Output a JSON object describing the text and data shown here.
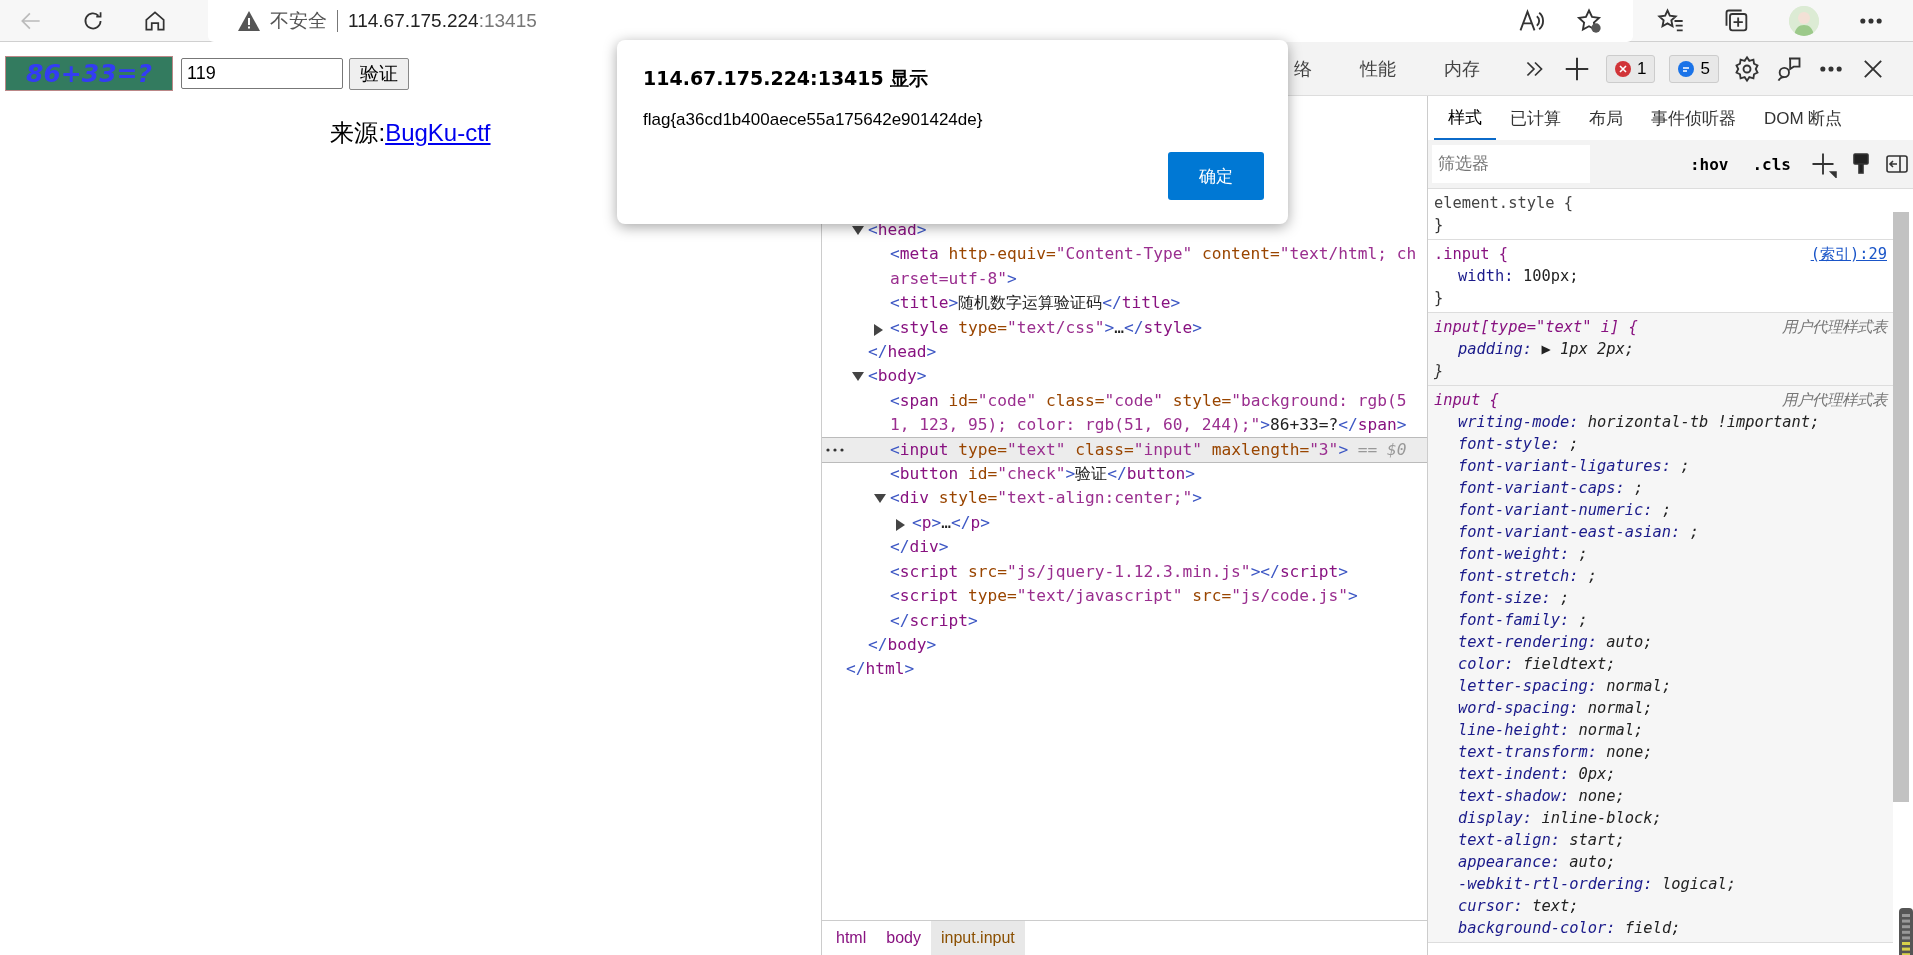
{
  "browser": {
    "address": {
      "security": "不安全",
      "host": "114.67.175.224",
      "port": ":13415"
    }
  },
  "page": {
    "captcha": "86+33=?",
    "answer_value": "119",
    "verify_button": "验证",
    "source_label": "来源:",
    "source_link": "BugKu-ctf"
  },
  "dialog": {
    "title": "114.67.175.224:13415 显示",
    "message": "flag{a36cd1b400aece55a175642e901424de}",
    "ok_button": "确定"
  },
  "devtools": {
    "tabs": [
      {
        "label": "络",
        "selected": false
      },
      {
        "label": "性能",
        "selected": false
      },
      {
        "label": "内存",
        "selected": false
      }
    ],
    "error_count": "1",
    "message_count": "5",
    "dom_tree": {
      "children": [
        {
          "selected": false,
          "expanded": true,
          "open": [
            {
              "kind": "punct",
              "t": "<"
            },
            {
              "kind": "tag",
              "t": "head"
            },
            {
              "kind": "punct",
              "t": ">"
            }
          ],
          "children": [
            {
              "selected": false,
              "open": [
                {
                  "kind": "punct",
                  "t": "<"
                },
                {
                  "kind": "tag",
                  "t": "meta"
                },
                {
                  "kind": "attr",
                  "t": " http-equiv="
                },
                {
                  "kind": "value",
                  "t": "\"Content-Type\""
                },
                {
                  "kind": "attr",
                  "t": " content="
                },
                {
                  "kind": "value",
                  "t": "\"text/html; charset=utf-8\""
                },
                {
                  "kind": "punct",
                  "t": ">"
                }
              ]
            },
            {
              "selected": false,
              "open": [
                {
                  "kind": "punct",
                  "t": "<"
                },
                {
                  "kind": "tag",
                  "t": "title"
                },
                {
                  "kind": "punct",
                  "t": ">"
                },
                {
                  "kind": "text",
                  "t": "随机数字运算验证码"
                },
                {
                  "kind": "punct",
                  "t": "</"
                },
                {
                  "kind": "tag",
                  "t": "title"
                },
                {
                  "kind": "punct",
                  "t": ">"
                }
              ]
            },
            {
              "selected": false,
              "expanded": false,
              "open": [
                {
                  "kind": "punct",
                  "t": "<"
                },
                {
                  "kind": "tag",
                  "t": "style"
                },
                {
                  "kind": "attr",
                  "t": " type="
                },
                {
                  "kind": "value",
                  "t": "\"text/css\""
                },
                {
                  "kind": "punct",
                  "t": ">"
                },
                {
                  "kind": "text",
                  "t": "…"
                },
                {
                  "kind": "punct",
                  "t": "</"
                },
                {
                  "kind": "tag",
                  "t": "style"
                },
                {
                  "kind": "punct",
                  "t": ">"
                }
              ]
            }
          ],
          "close": [
            {
              "kind": "punct",
              "t": "</"
            },
            {
              "kind": "tag",
              "t": "head"
            },
            {
              "kind": "punct",
              "t": ">"
            }
          ]
        },
        {
          "selected": false,
          "expanded": true,
          "open": [
            {
              "kind": "punct",
              "t": "<"
            },
            {
              "kind": "tag",
              "t": "body"
            },
            {
              "kind": "punct",
              "t": ">"
            }
          ],
          "children": [
            {
              "selected": false,
              "open": [
                {
                  "kind": "punct",
                  "t": "<"
                },
                {
                  "kind": "tag",
                  "t": "span"
                },
                {
                  "kind": "attr",
                  "t": " id="
                },
                {
                  "kind": "value",
                  "t": "\"code\""
                },
                {
                  "kind": "attr",
                  "t": " class="
                },
                {
                  "kind": "value",
                  "t": "\"code\""
                },
                {
                  "kind": "attr",
                  "t": " style="
                },
                {
                  "kind": "value",
                  "t": "\"background: rgb(51, 123, 95); color: rgb(51, 60, 244);\""
                },
                {
                  "kind": "punct",
                  "t": ">"
                },
                {
                  "kind": "text",
                  "t": "86+33=?"
                },
                {
                  "kind": "punct",
                  "t": "</"
                },
                {
                  "kind": "tag",
                  "t": "span"
                },
                {
                  "kind": "punct",
                  "t": ">"
                }
              ]
            },
            {
              "selected": true,
              "open": [
                {
                  "kind": "punct",
                  "t": "<"
                },
                {
                  "kind": "tag",
                  "t": "input"
                },
                {
                  "kind": "attr",
                  "t": " type="
                },
                {
                  "kind": "value",
                  "t": "\"text\""
                },
                {
                  "kind": "attr",
                  "t": " class="
                },
                {
                  "kind": "value",
                  "t": "\"input\""
                },
                {
                  "kind": "attr",
                  "t": " maxlength="
                },
                {
                  "kind": "value",
                  "t": "\"3\""
                },
                {
                  "kind": "punct",
                  "t": ">"
                },
                {
                  "kind": "hint",
                  "t": " == $0"
                }
              ]
            },
            {
              "selected": false,
              "open": [
                {
                  "kind": "punct",
                  "t": "<"
                },
                {
                  "kind": "tag",
                  "t": "button"
                },
                {
                  "kind": "attr",
                  "t": " id="
                },
                {
                  "kind": "value",
                  "t": "\"check\""
                },
                {
                  "kind": "punct",
                  "t": ">"
                },
                {
                  "kind": "text",
                  "t": "验证"
                },
                {
                  "kind": "punct",
                  "t": "</"
                },
                {
                  "kind": "tag",
                  "t": "button"
                },
                {
                  "kind": "punct",
                  "t": ">"
                }
              ]
            },
            {
              "selected": false,
              "expanded": true,
              "open": [
                {
                  "kind": "punct",
                  "t": "<"
                },
                {
                  "kind": "tag",
                  "t": "div"
                },
                {
                  "kind": "attr",
                  "t": " style="
                },
                {
                  "kind": "value",
                  "t": "\"text-align:center;\""
                },
                {
                  "kind": "punct",
                  "t": ">"
                }
              ],
              "children": [
                {
                  "selected": false,
                  "expanded": false,
                  "open": [
                    {
                      "kind": "punct",
                      "t": "<"
                    },
                    {
                      "kind": "tag",
                      "t": "p"
                    },
                    {
                      "kind": "punct",
                      "t": ">"
                    },
                    {
                      "kind": "text",
                      "t": "…"
                    },
                    {
                      "kind": "punct",
                      "t": "</"
                    },
                    {
                      "kind": "tag",
                      "t": "p"
                    },
                    {
                      "kind": "punct",
                      "t": ">"
                    }
                  ]
                }
              ],
              "close": [
                {
                  "kind": "punct",
                  "t": "</"
                },
                {
                  "kind": "tag",
                  "t": "div"
                },
                {
                  "kind": "punct",
                  "t": ">"
                }
              ]
            },
            {
              "selected": false,
              "open": [
                {
                  "kind": "punct",
                  "t": "<"
                },
                {
                  "kind": "tag",
                  "t": "script"
                },
                {
                  "kind": "attr",
                  "t": " src="
                },
                {
                  "kind": "value",
                  "t": "\"js/jquery-1.12.3.min.js\""
                },
                {
                  "kind": "punct",
                  "t": "></"
                },
                {
                  "kind": "tag",
                  "t": "script"
                },
                {
                  "kind": "punct",
                  "t": ">"
                }
              ]
            },
            {
              "selected": false,
              "open": [
                {
                  "kind": "punct",
                  "t": "<"
                },
                {
                  "kind": "tag",
                  "t": "script"
                },
                {
                  "kind": "attr",
                  "t": " type="
                },
                {
                  "kind": "value",
                  "t": "\"text/javascript\""
                },
                {
                  "kind": "attr",
                  "t": " src="
                },
                {
                  "kind": "value",
                  "t": "\"js/code.js\""
                },
                {
                  "kind": "punct",
                  "t": ">"
                }
              ],
              "close": [
                {
                  "kind": "punct",
                  "t": "</"
                },
                {
                  "kind": "tag",
                  "t": "script"
                },
                {
                  "kind": "punct",
                  "t": ">"
                }
              ]
            }
          ],
          "close": [
            {
              "kind": "punct",
              "t": "</"
            },
            {
              "kind": "tag",
              "t": "body"
            },
            {
              "kind": "punct",
              "t": ">"
            }
          ]
        }
      ],
      "close": [
        {
          "kind": "punct",
          "t": "</"
        },
        {
          "kind": "tag",
          "t": "html"
        },
        {
          "kind": "punct",
          "t": ">"
        }
      ]
    },
    "breadcrumbs": [
      {
        "label": "html",
        "selected": false
      },
      {
        "label": "body",
        "selected": false
      },
      {
        "label": "input.input",
        "selected": true
      }
    ],
    "styles_tabs": [
      {
        "label": "样式",
        "selected": true
      },
      {
        "label": "已计算",
        "selected": false
      },
      {
        "label": "布局",
        "selected": false
      },
      {
        "label": "事件侦听器",
        "selected": false
      },
      {
        "label": "DOM 断点",
        "selected": false
      }
    ],
    "filter": {
      "placeholder": "筛选器"
    },
    "hov_button": ":hov",
    "cls_button": ".cls",
    "rules": [
      {
        "kind": "inline",
        "selector": "element.style {",
        "close": "}"
      },
      {
        "kind": "author",
        "selector": ".input {",
        "source": "(索引):29",
        "close": "}",
        "properties": [
          {
            "name": "width:",
            "value": "100px;"
          }
        ]
      },
      {
        "kind": "user-agent",
        "selector": "input[type=\"text\" i] {",
        "source": "用户代理样式表",
        "close": "}",
        "properties": [
          {
            "name": "padding:",
            "marker": "▶",
            "value": "1px 2px;"
          }
        ]
      },
      {
        "kind": "user-agent",
        "selector": "input {",
        "source": "用户代理样式表",
        "properties": [
          {
            "name": "writing-mode:",
            "value": "horizontal-tb !important;"
          },
          {
            "name": "font-style:",
            "value": ";"
          },
          {
            "name": "font-variant-ligatures:",
            "value": ";"
          },
          {
            "name": "font-variant-caps:",
            "value": ";"
          },
          {
            "name": "font-variant-numeric:",
            "value": ";"
          },
          {
            "name": "font-variant-east-asian:",
            "value": ";"
          },
          {
            "name": "font-weight:",
            "value": ";"
          },
          {
            "name": "font-stretch:",
            "value": ";"
          },
          {
            "name": "font-size:",
            "value": ";"
          },
          {
            "name": "font-family:",
            "value": ";"
          },
          {
            "name": "text-rendering:",
            "value": "auto;"
          },
          {
            "name": "color:",
            "value": "fieldtext;"
          },
          {
            "name": "letter-spacing:",
            "value": "normal;"
          },
          {
            "name": "word-spacing:",
            "value": "normal;"
          },
          {
            "name": "line-height:",
            "value": "normal;"
          },
          {
            "name": "text-transform:",
            "value": "none;"
          },
          {
            "name": "text-indent:",
            "value": "0px;"
          },
          {
            "name": "text-shadow:",
            "value": "none;"
          },
          {
            "name": "display:",
            "value": "inline-block;"
          },
          {
            "name": "text-align:",
            "value": "start;"
          },
          {
            "name": "appearance:",
            "value": "auto;"
          },
          {
            "name": "-webkit-rtl-ordering:",
            "value": "logical;"
          },
          {
            "name": "cursor:",
            "value": "text;"
          },
          {
            "name": "background-color:",
            "value": "field;"
          }
        ]
      }
    ]
  }
}
